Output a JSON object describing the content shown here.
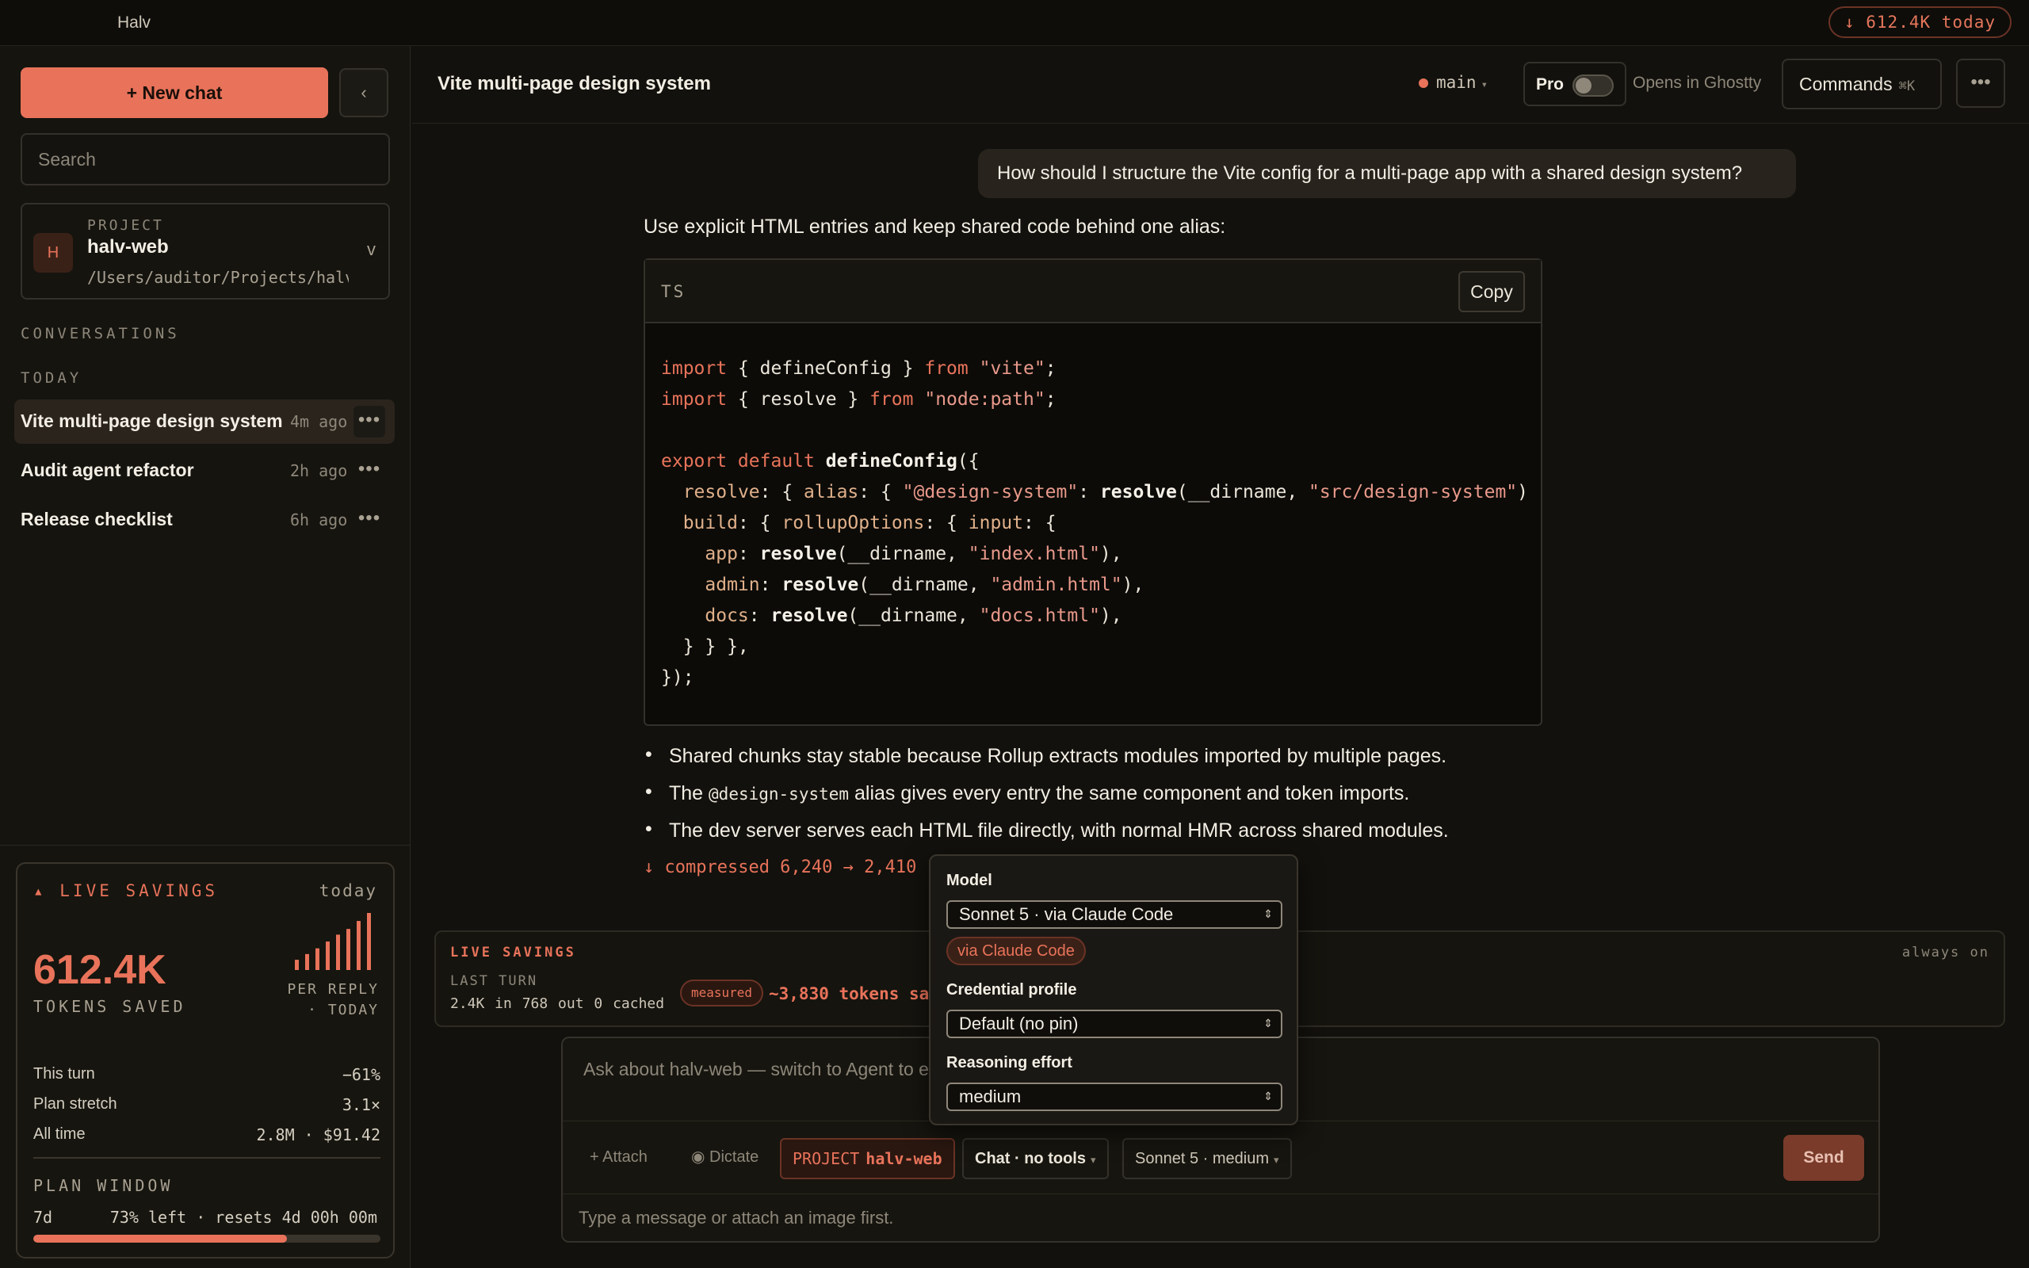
{
  "topbar": {
    "app_name": "Halv",
    "today_badge": "↓ 612.4K today"
  },
  "sidebar": {
    "new_chat": "+ New chat",
    "collapse_icon": "‹",
    "search_placeholder": "Search",
    "project": {
      "avatar": "H",
      "tag": "PROJECT",
      "name": "halv-web",
      "path": "/Users/auditor/Projects/halv-web",
      "chevron": "v"
    },
    "conversations_label": "CONVERSATIONS",
    "today_label": "TODAY",
    "conversations": [
      {
        "title": "Vite multi-page design system",
        "time": "4m ago"
      },
      {
        "title": "Audit agent refactor",
        "time": "2h ago"
      },
      {
        "title": "Release checklist",
        "time": "6h ago"
      }
    ],
    "savings": {
      "title": "▴ LIVE SAVINGS",
      "period": "today",
      "value": "612.4K",
      "value_label": "TOKENS SAVED",
      "per_reply": "PER REPLY",
      "per_reply_sub": "· TODAY",
      "spark_values": [
        18,
        28,
        38,
        50,
        62,
        72,
        86,
        100
      ],
      "rows": [
        {
          "label": "This turn",
          "value": "−61%"
        },
        {
          "label": "Plan stretch",
          "value": "3.1×"
        },
        {
          "label": "All time",
          "value": "2.8M · $91.42"
        }
      ],
      "plan_title": "PLAN WINDOW",
      "plan_period": "7d",
      "plan_text": "73% left · resets 4d 00h 00m",
      "plan_used_fraction": 0.73
    }
  },
  "header": {
    "title": "Vite multi-page design system",
    "branch": "main",
    "pro_label": "Pro",
    "opens_in": "Opens in Ghostty",
    "commands": "Commands",
    "commands_kbd": "⌘K",
    "more": "•••"
  },
  "messages": {
    "user": "How should I structure the Vite config for a multi-page app with a shared design system?",
    "reply_intro": "Use explicit HTML entries and keep shared code behind one alias:",
    "code_lang": "TS",
    "copy_label": "Copy",
    "bullets": [
      {
        "pre": "Shared chunks stay stable because Rollup extracts modules imported by multiple pages.",
        "code": "",
        "post": ""
      },
      {
        "pre": "The ",
        "code": "@design-system",
        "post": " alias gives every entry the same component and token imports."
      },
      {
        "pre": "The dev server serves each HTML file directly, with normal HMR across shared modules.",
        "code": "",
        "post": ""
      }
    ],
    "compressed": "↓ compressed 6,240 → 2,410"
  },
  "live_panel": {
    "title": "LIVE SAVINGS",
    "always_on": "always on",
    "last_turn": "LAST TURN",
    "stats": "2.4K in  768 out  0 cached",
    "measured": "measured",
    "saved": "~3,830 tokens saved"
  },
  "composer": {
    "placeholder": "Ask about halv-web — switch to Agent to edit files",
    "attach": "+ Attach",
    "dictate": "◉ Dictate",
    "project_tag": "PROJECT",
    "project_name": "halv-web",
    "mode": "Chat · no tools",
    "model": "Sonnet 5 · medium",
    "send": "Send",
    "hint": "Type a message or attach an image first."
  },
  "popup": {
    "model_label": "Model",
    "model_value": "Sonnet 5 · via Claude Code",
    "via_badge": "via Claude Code",
    "credential_label": "Credential profile",
    "credential_value": "Default (no pin)",
    "reasoning_label": "Reasoning effort",
    "reasoning_value": "medium"
  },
  "colors": {
    "accent": "#e8735a",
    "background": "#12110d",
    "panel": "#15140f"
  }
}
